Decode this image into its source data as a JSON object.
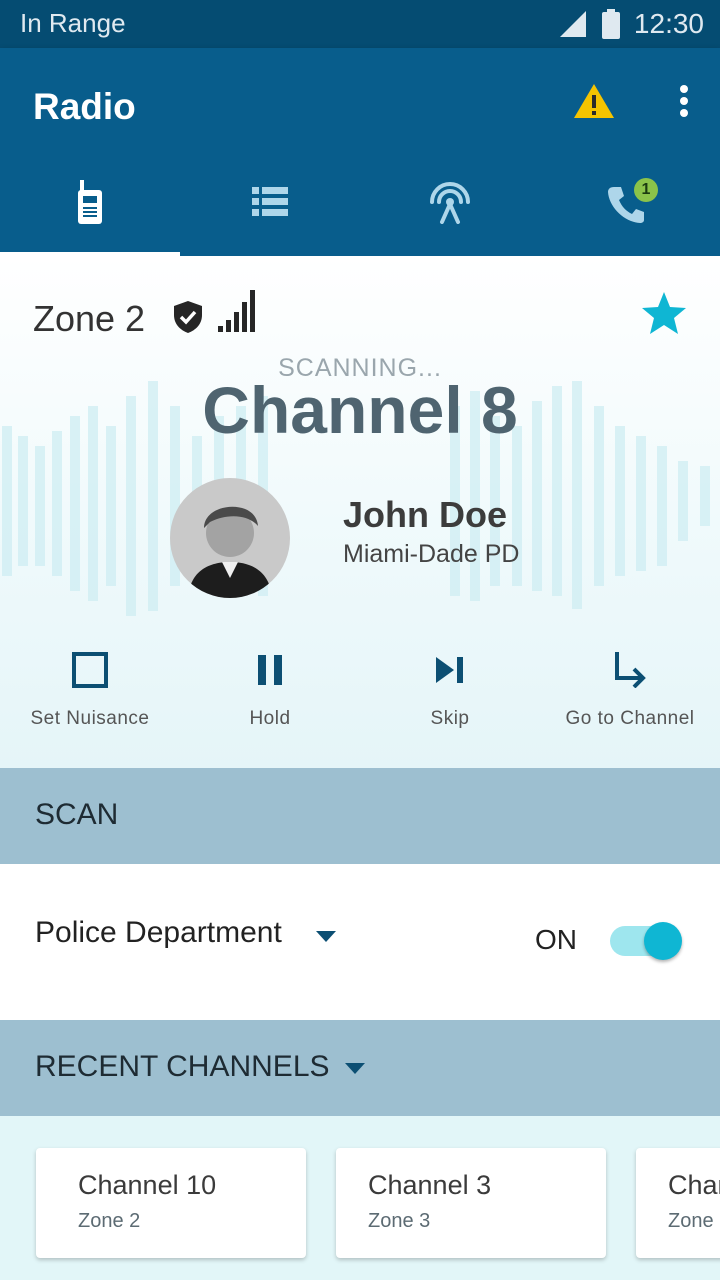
{
  "status_bar": {
    "left_text": "In Range",
    "time": "12:30"
  },
  "app_bar": {
    "title": "Radio",
    "badge_count": "1"
  },
  "tabs": [
    {
      "icon": "radio-icon",
      "selected": true
    },
    {
      "icon": "list-icon",
      "selected": false
    },
    {
      "icon": "antenna-icon",
      "selected": false
    },
    {
      "icon": "phone-icon",
      "selected": false
    }
  ],
  "hero": {
    "zone": "Zone 2",
    "status": "SCANNING...",
    "channel": "Channel 8",
    "caller_name": "John Doe",
    "caller_org": "Miami-Dade PD"
  },
  "actions": [
    {
      "label": "Set Nuisance",
      "icon": "checkbox-icon"
    },
    {
      "label": "Hold",
      "icon": "pause-icon"
    },
    {
      "label": "Skip",
      "icon": "skip-icon"
    },
    {
      "label": "Go to Channel",
      "icon": "go-to-arrow-icon"
    }
  ],
  "scan": {
    "header": "SCAN",
    "list_name": "Police Department",
    "toggle_label": "ON",
    "toggle_on": true
  },
  "recent": {
    "header": "RECENT CHANNELS",
    "channels": [
      {
        "name": "Channel 10",
        "zone": "Zone 2"
      },
      {
        "name": "Channel 3",
        "zone": "Zone 3"
      },
      {
        "name": "Channel",
        "zone": "Zone"
      }
    ]
  },
  "colors": {
    "primary": "#085d8c",
    "statusbar": "#054c72",
    "accent": "#0fb6d3",
    "section": "#9dbfd0",
    "warning": "#f5c400"
  }
}
